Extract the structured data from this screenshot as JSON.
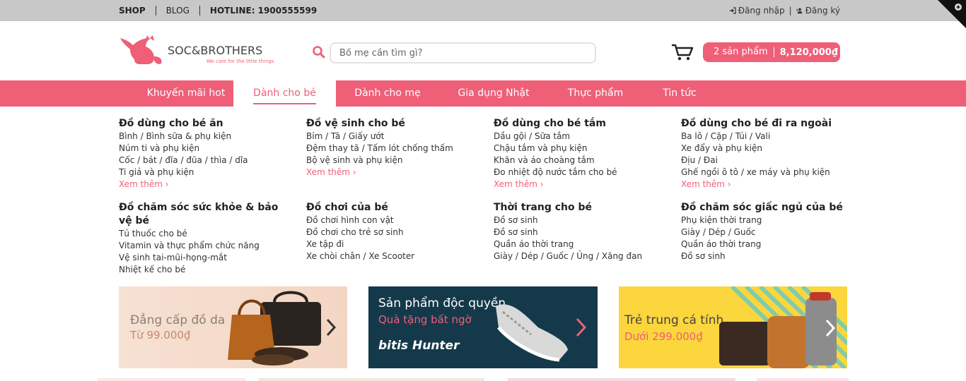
{
  "topbar": {
    "links": [
      "SHOP",
      "BLOG",
      "HOTLINE: 1900555599"
    ],
    "login": "Đăng nhập",
    "register": "Đăng ký"
  },
  "logo": {
    "brand": "SOC&BROTHERS",
    "tagline": "We care for the little things"
  },
  "search": {
    "placeholder": "Bố mẹ cần tìm gì?"
  },
  "cart": {
    "count_label": "2 sản phẩm",
    "total": "8,120,000₫"
  },
  "nav": {
    "items": [
      "Khuyến mãi hot",
      "Dành cho bé",
      "Dành cho mẹ",
      "Gia dụng Nhật",
      "Thực phẩm",
      "Tin tức"
    ],
    "active_index": 1
  },
  "mega_menu": {
    "more_label": "Xem thêm",
    "columns": [
      {
        "title": "Đồ dùng cho bé ăn",
        "links": [
          "Bình / Bình sữa & phụ kiện",
          "Núm ti và phụ kiện",
          "Cốc / bát / đĩa / đũa / thìa / dĩa",
          "Ti giả và phụ kiện"
        ]
      },
      {
        "title": "Đồ vệ sinh cho bé",
        "links": [
          "Bỉm / Tã / Giấy ướt",
          "Đệm thay tã / Tấm lót chống thấm",
          "Bộ vệ sinh và phụ kiện"
        ]
      },
      {
        "title": "Đồ dùng cho bé tắm",
        "links": [
          "Dầu gội / Sữa tắm",
          "Chậu tắm và phụ kiện",
          "Khăn và áo choàng tắm",
          "Đo nhiệt độ nước tắm cho bé"
        ]
      },
      {
        "title": "Đồ dùng cho bé đi ra ngoài",
        "links": [
          "Ba lô / Cặp / Túi / Vali",
          "Xe đẩy và phụ kiện",
          "Địu / Đai",
          "Ghế ngồi ô tô / xe máy và phụ kiện"
        ]
      },
      {
        "title": "Đồ chăm sóc sức khỏe & bảo vệ bé",
        "links": [
          "Tủ thuốc cho bé",
          "Vitamin và thực phẩm chức năng",
          "Vệ sinh tai-mũi-họng-mắt",
          "Nhiệt kế cho bé"
        ]
      },
      {
        "title": "Đồ chơi của bé",
        "links": [
          "Đồ chơi hình con vật",
          "Đồ chơi cho trẻ sơ sinh",
          "Xe tập đi",
          "Xe chòi chân / Xe Scooter"
        ]
      },
      {
        "title": "Thời trang cho bé",
        "links": [
          "Đồ sơ sinh",
          "Đồ sơ sinh",
          "Quần áo thời trang",
          "Giày / Dép / Guốc / Ủng / Xăng đan"
        ]
      },
      {
        "title": "Đồ chăm sóc giấc ngủ của bé",
        "links": [
          "Phụ kiện thời trang",
          "Giày / Dép / Guốc",
          "Quần áo thời trang",
          "Đồ sơ sinh"
        ]
      }
    ]
  },
  "banners": [
    {
      "line1": "Đẳng cấp đồ da",
      "line2": "Từ 99.000₫"
    },
    {
      "line1": "Sản phẩm độc quyền",
      "line2": "Quà tặng bất ngờ",
      "brand": "bitis Hunter"
    },
    {
      "line1": "Trẻ trung cá tính",
      "line2": "Dưới 299.000₫"
    }
  ],
  "colors": {
    "accent": "#ef5f78",
    "topbar": "#c8c8c8"
  }
}
